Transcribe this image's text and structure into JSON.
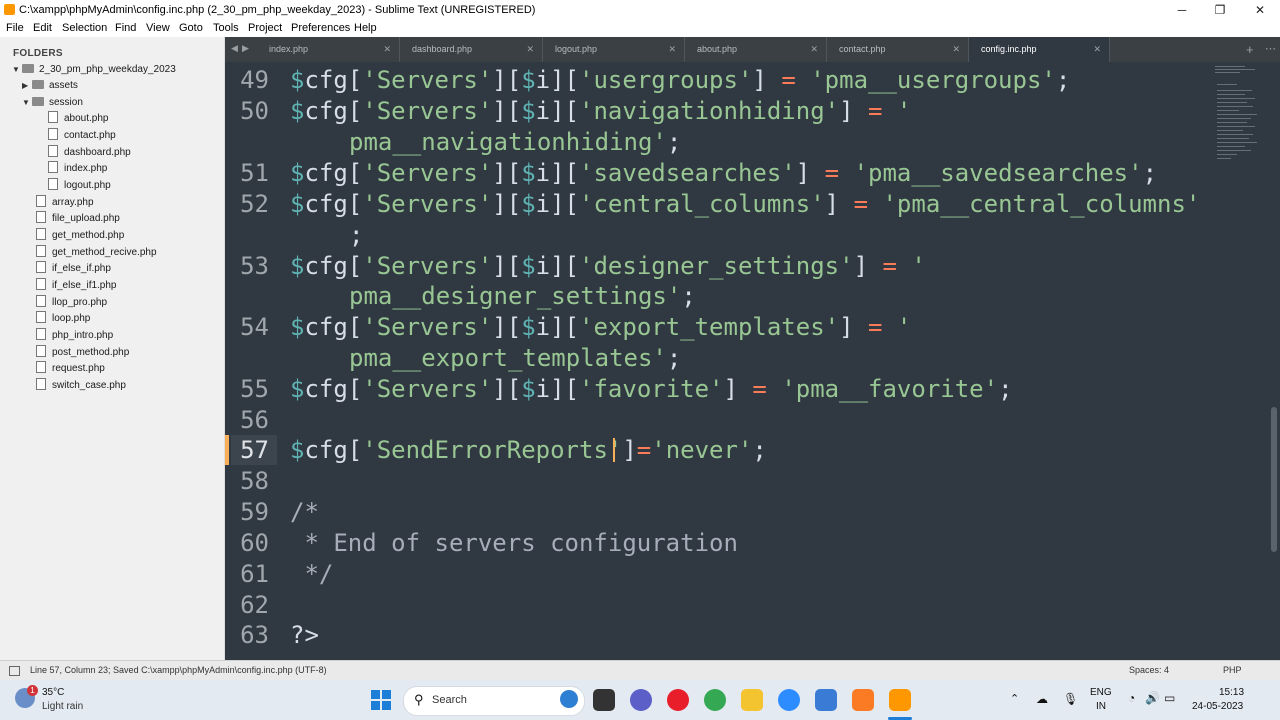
{
  "window": {
    "title": "C:\\xampp\\phpMyAdmin\\config.inc.php (2_30_pm_php_weekday_2023) - Sublime Text (UNREGISTERED)",
    "minimize": "─",
    "maximize": "❐",
    "close": "✕"
  },
  "menu": [
    "File",
    "Edit",
    "Selection",
    "Find",
    "View",
    "Goto",
    "Tools",
    "Project",
    "Preferences",
    "Help"
  ],
  "sidebar": {
    "header": "FOLDERS",
    "root": "2_30_pm_php_weekday_2023",
    "folders": [
      "assets",
      "session"
    ],
    "session_files": [
      "about.php",
      "contact.php",
      "dashboard.php",
      "index.php",
      "logout.php"
    ],
    "files": [
      "array.php",
      "file_upload.php",
      "get_method.php",
      "get_method_recive.php",
      "if_else_if.php",
      "if_else_if1.php",
      "llop_pro.php",
      "loop.php",
      "php_intro.php",
      "post_method.php",
      "request.php",
      "switch_case.php"
    ]
  },
  "tabs": [
    {
      "label": "index.php",
      "close": "✕"
    },
    {
      "label": "dashboard.php",
      "close": "✕"
    },
    {
      "label": "logout.php",
      "close": "✕"
    },
    {
      "label": "about.php",
      "close": "✕"
    },
    {
      "label": "contact.php",
      "close": "✕"
    },
    {
      "label": "config.inc.php",
      "close": "✕"
    }
  ],
  "tab_nav": {
    "prev": "◀",
    "next": "▶",
    "add": "+",
    "more": "⋯"
  },
  "editor": {
    "line_numbers": [
      "49",
      "50",
      "",
      "51",
      "52",
      "",
      "53",
      "",
      "54",
      "",
      "55",
      "56",
      "57",
      "58",
      "59",
      "60",
      "61",
      "62",
      "63"
    ],
    "current_line": "57"
  },
  "status": {
    "left": "Line 57, Column 23; Saved C:\\xampp\\phpMyAdmin\\config.inc.php (UTF-8)",
    "spaces": "Spaces: 4",
    "syntax": "PHP"
  },
  "taskbar": {
    "weather_temp": "35°C",
    "weather_desc": "Light rain",
    "weather_badge": "1",
    "search": "Search",
    "lang_top": "ENG",
    "lang_bottom": "IN",
    "time": "15:13",
    "date": "24-05-2023"
  },
  "colors": {
    "editor_bg": "#303841",
    "variable": "#5fb3b3",
    "string": "#99c794",
    "operator": "#f97b58",
    "caret": "#f9ae58"
  }
}
